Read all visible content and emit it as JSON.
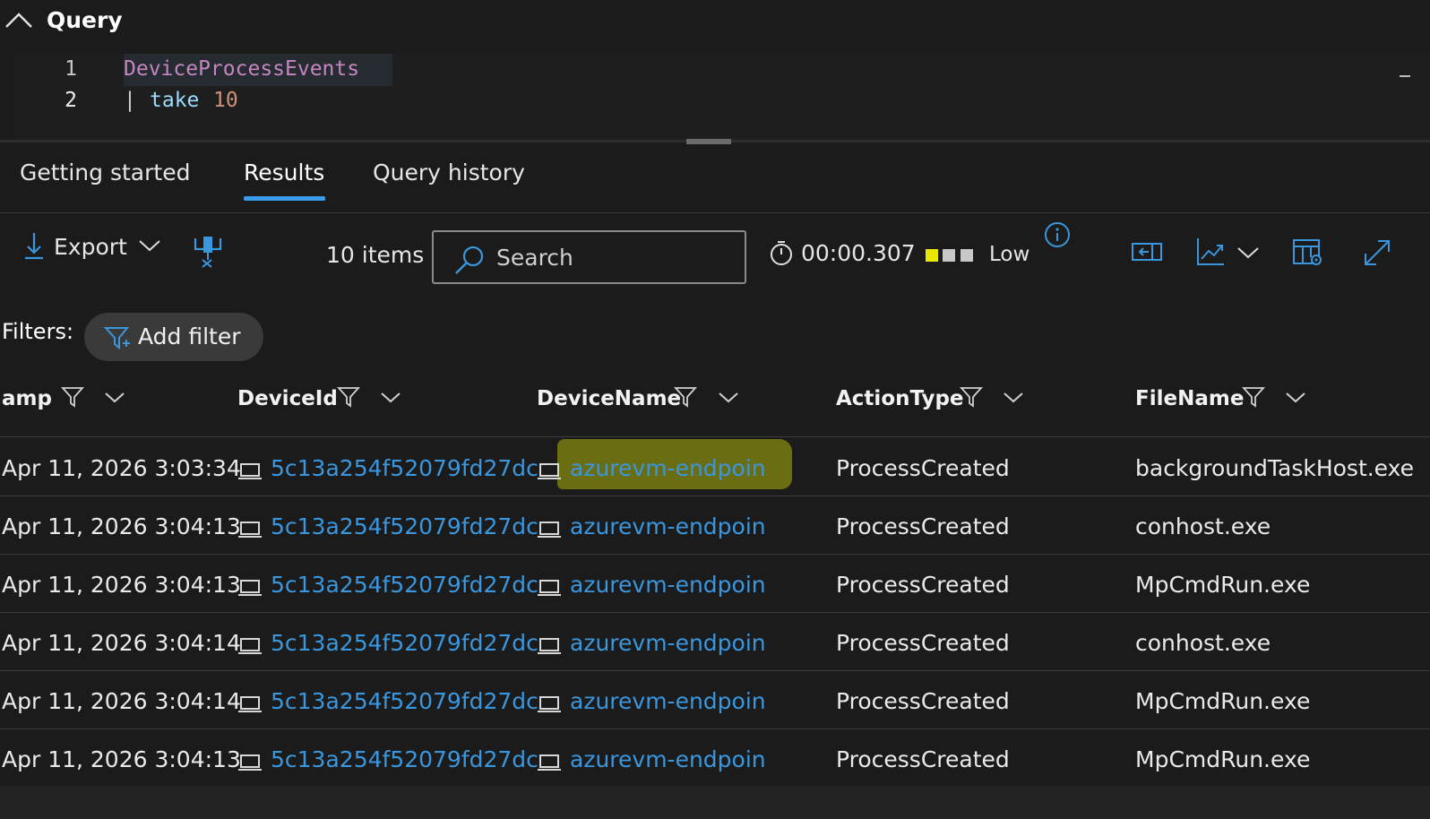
{
  "query_panel": {
    "title": "Query",
    "lines": [
      {
        "number": "1",
        "tokens": [
          "DeviceProcessEvents"
        ]
      },
      {
        "number": "2",
        "tokens": [
          "|",
          "take",
          "10"
        ]
      }
    ]
  },
  "tabs": [
    {
      "label": "Getting started",
      "active": false
    },
    {
      "label": "Results",
      "active": true
    },
    {
      "label": "Query history",
      "active": false
    }
  ],
  "toolbar": {
    "export_label": "Export",
    "item_count": "10 items",
    "search_placeholder": "Search",
    "duration": "00:00.307",
    "resource_level": "Low",
    "resource_level_colors": [
      "#e8e800",
      "#c8c8c8",
      "#c8c8c8"
    ]
  },
  "filters": {
    "label": "Filters:",
    "add_filter_label": "Add filter"
  },
  "table": {
    "columns": [
      "amp",
      "DeviceId",
      "DeviceName",
      "ActionType",
      "FileName"
    ],
    "rows": [
      {
        "timestamp": "Apr 11, 2026 3:03:34",
        "device_id": "5c13a254f52079fd27dc",
        "device_name": "azurevm-endpoin",
        "action_type": "ProcessCreated",
        "file_name": "backgroundTaskHost.exe"
      },
      {
        "timestamp": "Apr 11, 2026 3:04:13",
        "device_id": "5c13a254f52079fd27dc",
        "device_name": "azurevm-endpoin",
        "action_type": "ProcessCreated",
        "file_name": "conhost.exe"
      },
      {
        "timestamp": "Apr 11, 2026 3:04:13",
        "device_id": "5c13a254f52079fd27dc",
        "device_name": "azurevm-endpoin",
        "action_type": "ProcessCreated",
        "file_name": "MpCmdRun.exe"
      },
      {
        "timestamp": "Apr 11, 2026 3:04:14",
        "device_id": "5c13a254f52079fd27dc",
        "device_name": "azurevm-endpoin",
        "action_type": "ProcessCreated",
        "file_name": "conhost.exe"
      },
      {
        "timestamp": "Apr 11, 2026 3:04:14",
        "device_id": "5c13a254f52079fd27dc",
        "device_name": "azurevm-endpoin",
        "action_type": "ProcessCreated",
        "file_name": "MpCmdRun.exe"
      },
      {
        "timestamp": "Apr 11, 2026 3:04:13",
        "device_id": "5c13a254f52079fd27dc",
        "device_name": "azurevm-endpoin",
        "action_type": "ProcessCreated",
        "file_name": "MpCmdRun.exe"
      }
    ]
  },
  "colors": {
    "link": "#3a96dd",
    "accent": "#3b9bea",
    "highlight": "#6b6d12",
    "keyword_table": "#c586c0",
    "keyword_operator": "#9cdcfe",
    "number": "#ce9178"
  }
}
